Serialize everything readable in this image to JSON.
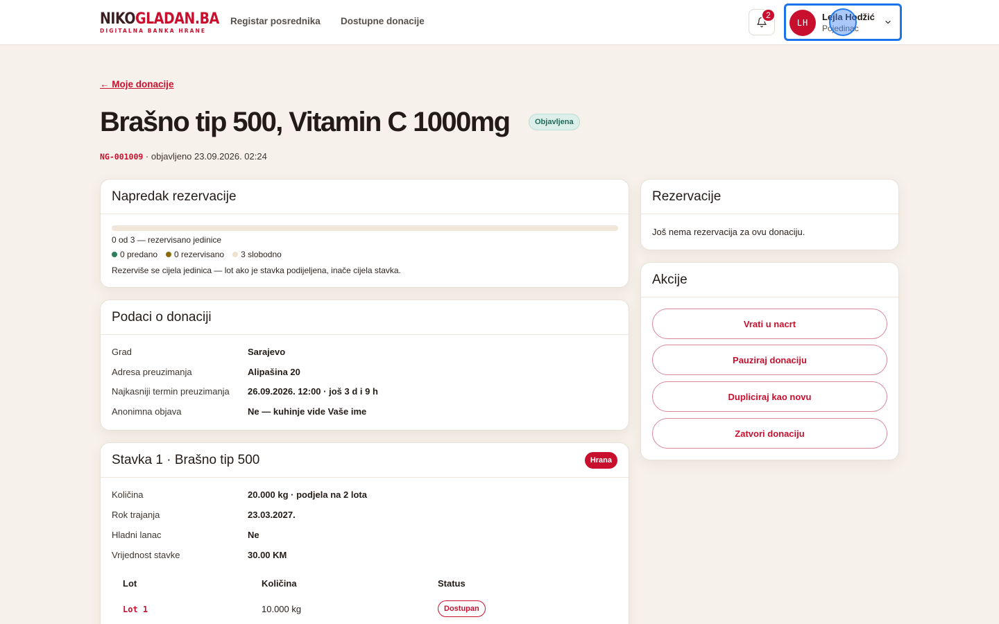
{
  "header": {
    "logo_dark": "NIKO",
    "logo_red": "GLADAN.BA",
    "logo_tagline": "DIGITALNA BANKA HRANE",
    "nav": [
      {
        "label": "Registar posrednika"
      },
      {
        "label": "Dostupne donacije"
      }
    ],
    "notifications_count": "2",
    "user": {
      "initials": "LH",
      "name": "Lejla Hodžić",
      "role": "Pojedinac"
    }
  },
  "page": {
    "back_link": "← Moje donacije",
    "title": "Brašno tip 500, Vitamin C 1000mg",
    "status": "Objavljena",
    "code": "NG-001009",
    "meta_text": " · objavljeno 23.09.2026. 02:24"
  },
  "progress_card": {
    "title": "Napredak rezervacije",
    "progress_fraction": 0,
    "summary": "0 od 3 — rezervisano jedinice",
    "legend": [
      {
        "label": "0 predano",
        "color": "#2e7d5b"
      },
      {
        "label": "0 rezervisano",
        "color": "#8a6a0b"
      },
      {
        "label": "3 slobodno",
        "color": "#f1e2cf"
      }
    ],
    "note": "Rezerviše se cijela jedinica — lot ako je stavka podijeljena, inače cijela stavka."
  },
  "details_card": {
    "title": "Podaci o donaciji",
    "rows": [
      {
        "label": "Grad",
        "value": "Sarajevo"
      },
      {
        "label": "Adresa preuzimanja",
        "value": "Alipašina 20"
      },
      {
        "label": "Najkasniji termin preuzimanja",
        "value": "26.09.2026. 12:00 · još 3 d i 9 h"
      },
      {
        "label": "Anonimna objava",
        "value": "Ne — kuhinje vide Vaše ime"
      }
    ]
  },
  "item_card": {
    "title": "Stavka 1 · Brašno tip 500",
    "category": "Hrana",
    "rows": [
      {
        "label": "Količina",
        "value": "20.000 kg · podjela na 2 lota"
      },
      {
        "label": "Rok trajanja",
        "value": "23.03.2027."
      },
      {
        "label": "Hladni lanac",
        "value": "Ne"
      },
      {
        "label": "Vrijednost stavke",
        "value": "30.00 KM"
      }
    ],
    "table": {
      "headers": [
        "Lot",
        "Količina",
        "Status"
      ],
      "rows": [
        {
          "lot": "Lot 1",
          "quantity": "10.000 kg",
          "status": "Dostupan"
        }
      ]
    }
  },
  "reservations_card": {
    "title": "Rezervacije",
    "empty_text": "Još nema rezervacija za ovu donaciju."
  },
  "actions_card": {
    "title": "Akcije",
    "buttons": [
      {
        "label": "Vrati u nacrt"
      },
      {
        "label": "Pauziraj donaciju"
      },
      {
        "label": "Dupliciraj kao novu"
      },
      {
        "label": "Zatvori donaciju"
      }
    ]
  },
  "colors": {
    "brand": "#c8102e",
    "background": "#f6f1ea",
    "focus": "#1a73e8"
  },
  "icons": {
    "notifications": "bell-icon",
    "user_menu": "chevron-down-icon"
  }
}
